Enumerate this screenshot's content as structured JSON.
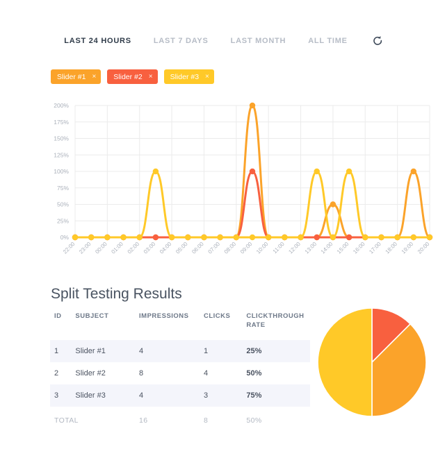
{
  "range_tabs": [
    {
      "label": "LAST 24 HOURS",
      "active": true
    },
    {
      "label": "LAST 7 DAYS",
      "active": false
    },
    {
      "label": "LAST MONTH",
      "active": false
    },
    {
      "label": "ALL TIME",
      "active": false
    }
  ],
  "refresh_icon": "refresh-icon",
  "legend_chips": [
    {
      "label": "Slider #1",
      "color": "#FBA32A",
      "close": "×"
    },
    {
      "label": "Slider #2",
      "color": "#F8603F",
      "close": "×"
    },
    {
      "label": "Slider #3",
      "color": "#FFC928",
      "close": "×"
    }
  ],
  "colors": {
    "slider1": "#FBA32A",
    "slider2": "#F8603F",
    "slider3": "#FFC928",
    "ctr_green": "#3ECFA0",
    "grid": "#EBEBEB",
    "axis_text": "#AAB0BA"
  },
  "results": {
    "title": "Split Testing Results",
    "columns": [
      "ID",
      "SUBJECT",
      "IMPRESSIONS",
      "CLICKS",
      "CLICKTHROUGH RATE"
    ],
    "rows": [
      {
        "id": "1",
        "subject": "Slider #1",
        "impressions": "4",
        "clicks": "1",
        "ctr": "25%"
      },
      {
        "id": "2",
        "subject": "Slider #2",
        "impressions": "8",
        "clicks": "4",
        "ctr": "50%"
      },
      {
        "id": "3",
        "subject": "Slider #3",
        "impressions": "4",
        "clicks": "3",
        "ctr": "75%"
      }
    ],
    "total": {
      "label": "TOTAL",
      "subject": "",
      "impressions": "16",
      "clicks": "8",
      "ctr": "50%"
    }
  },
  "chart_data": [
    {
      "type": "line",
      "title": "",
      "xlabel": "",
      "ylabel": "",
      "ylim": [
        0,
        200
      ],
      "yticks": [
        0,
        25,
        50,
        75,
        100,
        125,
        150,
        175,
        200
      ],
      "ytick_labels": [
        "0%",
        "25%",
        "50%",
        "75%",
        "100%",
        "125%",
        "150%",
        "175%",
        "200%"
      ],
      "grid": true,
      "legend_position": "top-left",
      "x": [
        "22:00",
        "23:00",
        "00:00",
        "01:00",
        "02:00",
        "03:00",
        "04:00",
        "05:00",
        "06:00",
        "07:00",
        "08:00",
        "09:00",
        "10:00",
        "11:00",
        "12:00",
        "13:00",
        "14:00",
        "15:00",
        "16:00",
        "17:00",
        "18:00",
        "19:00",
        "20:00"
      ],
      "series": [
        {
          "name": "Slider #1",
          "color": "#FBA32A",
          "values": [
            0,
            0,
            0,
            0,
            0,
            0,
            0,
            0,
            0,
            0,
            0,
            200,
            0,
            0,
            0,
            0,
            50,
            0,
            0,
            0,
            0,
            100,
            0
          ]
        },
        {
          "name": "Slider #2",
          "color": "#F8603F",
          "values": [
            0,
            0,
            0,
            0,
            0,
            0,
            0,
            0,
            0,
            0,
            0,
            100,
            0,
            0,
            0,
            0,
            0,
            0,
            0,
            0,
            0,
            0,
            0
          ]
        },
        {
          "name": "Slider #3",
          "color": "#FFC928",
          "values": [
            0,
            0,
            0,
            0,
            0,
            100,
            0,
            0,
            0,
            0,
            0,
            0,
            0,
            0,
            0,
            100,
            0,
            100,
            0,
            0,
            0,
            0,
            0
          ]
        }
      ]
    },
    {
      "type": "pie",
      "title": "",
      "labels": [
        "Slider #2",
        "Slider #1",
        "Slider #3"
      ],
      "values": [
        1,
        3,
        4
      ],
      "percents": [
        12.5,
        37.5,
        50
      ],
      "colors": [
        "#F8603F",
        "#FBA32A",
        "#FFC928"
      ],
      "legend_position": "none"
    }
  ]
}
